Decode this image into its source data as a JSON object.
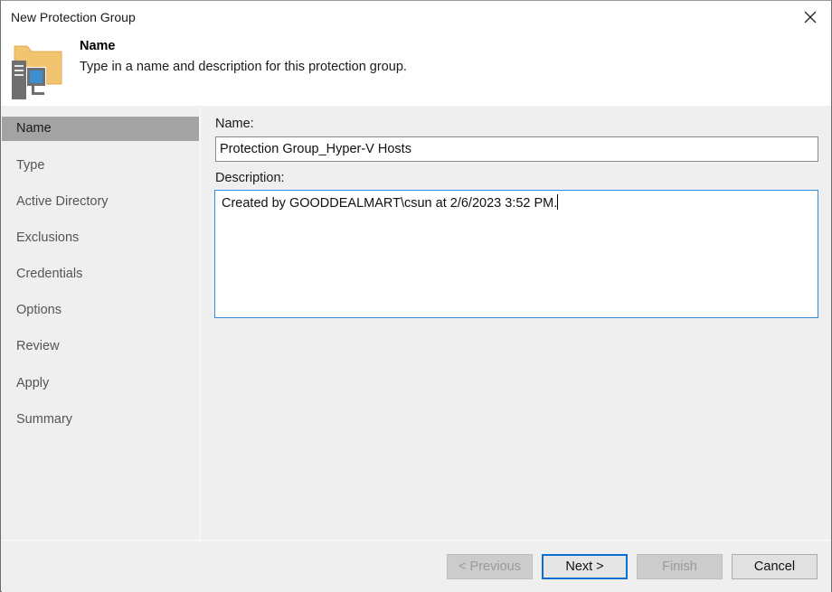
{
  "window": {
    "title": "New Protection Group",
    "close_icon": "close-icon"
  },
  "header": {
    "icon": "protection-group-icon",
    "step_title": "Name",
    "step_description": "Type in a name and description for this protection group."
  },
  "sidebar": {
    "items": [
      {
        "label": "Name",
        "active": true
      },
      {
        "label": "Type",
        "active": false
      },
      {
        "label": "Active Directory",
        "active": false
      },
      {
        "label": "Exclusions",
        "active": false
      },
      {
        "label": "Credentials",
        "active": false
      },
      {
        "label": "Options",
        "active": false
      },
      {
        "label": "Review",
        "active": false
      },
      {
        "label": "Apply",
        "active": false
      },
      {
        "label": "Summary",
        "active": false
      }
    ]
  },
  "form": {
    "name_label": "Name:",
    "name_value": "Protection Group_Hyper-V Hosts",
    "description_label": "Description:",
    "description_value": "Created by GOODDEALMART\\csun at 2/6/2023 3:52 PM."
  },
  "footer": {
    "previous_label": "< Previous",
    "next_label": "Next >",
    "finish_label": "Finish",
    "cancel_label": "Cancel"
  },
  "colors": {
    "accent": "#0a6fd1",
    "focus_border": "#2f8ee0",
    "active_nav_bg": "#a3a3a3",
    "folder": "#f3c46f"
  }
}
